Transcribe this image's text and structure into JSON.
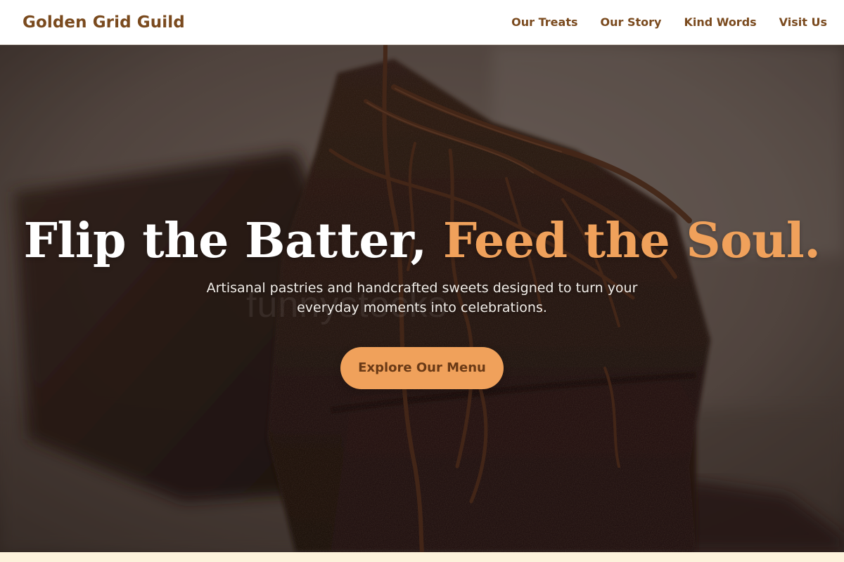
{
  "header": {
    "brand": "Golden Grid Guild",
    "nav": [
      {
        "label": "Our Treats"
      },
      {
        "label": "Our Story"
      },
      {
        "label": "Kind Words"
      },
      {
        "label": "Visit Us"
      }
    ]
  },
  "hero": {
    "title_main": "Flip the Batter, ",
    "title_accent": "Feed the Soul.",
    "subtitle": "Artisanal pastries and handcrafted sweets designed to turn your everyday moments into celebrations.",
    "cta_label": "Explore Our Menu",
    "watermark": "funnystocks"
  },
  "colors": {
    "brand_brown": "#7a4a1e",
    "accent_orange": "#f0a15b",
    "cream": "#fdf3dc"
  }
}
